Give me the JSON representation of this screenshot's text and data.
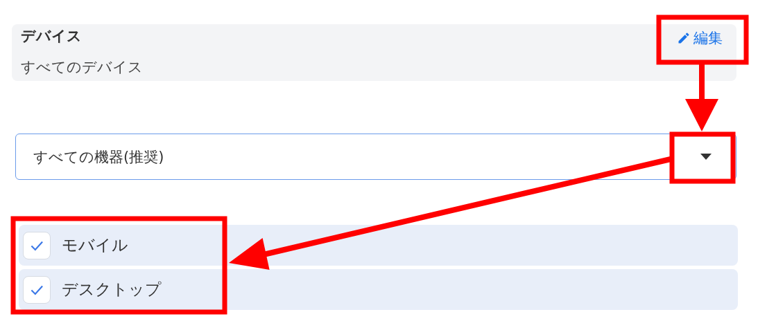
{
  "device_card": {
    "title": "デバイス",
    "summary": "すべてのデバイス",
    "edit_link": "編集"
  },
  "device_select": {
    "value": "すべての機器(推奨)"
  },
  "device_options": [
    {
      "label": "モバイル",
      "checked": true
    },
    {
      "label": "デスクトップ",
      "checked": true
    }
  ]
}
